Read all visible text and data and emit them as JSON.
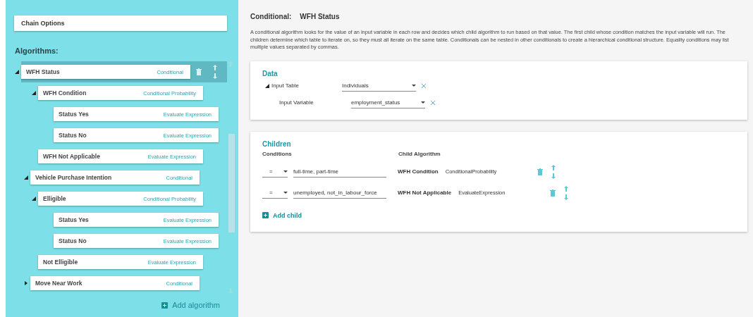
{
  "sidebar": {
    "chain_options": "Chain Options",
    "heading": "Algorithms:",
    "algorithms": [
      {
        "name": "WFH Status",
        "type": "Conditional",
        "selected": true,
        "expanded": true,
        "children": [
          {
            "name": "WFH Condition",
            "type": "Conditional Probability",
            "selected": false,
            "expanded": true,
            "children": [
              {
                "name": "Status Yes",
                "type": "Evaluate Expression",
                "selected": false
              },
              {
                "name": "Status No",
                "type": "Evaluate Expression",
                "selected": false
              }
            ]
          },
          {
            "name": "WFH Not Applicable",
            "type": "Evaluate Expression",
            "selected": false
          }
        ]
      },
      {
        "name": "Vehicle Purchase Intention",
        "type": "Conditional",
        "selected": false,
        "expanded": true,
        "children": [
          {
            "name": "Elligible",
            "type": "Conditional Probability",
            "selected": false,
            "expanded": true,
            "children": [
              {
                "name": "Status Yes",
                "type": "Evaluate Expression",
                "selected": false
              },
              {
                "name": "Status No",
                "type": "Evaluate Expression",
                "selected": false
              }
            ]
          },
          {
            "name": "Not Elligible",
            "type": "Evaluate Expression",
            "selected": false
          }
        ]
      },
      {
        "name": "Move Near Work",
        "type": "Conditional",
        "selected": false,
        "expanded": false
      }
    ],
    "add_button": "Add algorithm"
  },
  "detail": {
    "kind_label": "Conditional:",
    "title": "WFH Status",
    "description": "A conditional algorithm looks for the value of an input variable in each row and decides which child algorithm to run based on that value. The first child whose condition matches the input variable will run. The children determine which table to iterate on, so they must all iterate on the same table. Conditionals can be nested in other conditionals to create a hierarchical conditional structure. Equality conditions may list multiple values separated by commas.",
    "data": {
      "heading": "Data",
      "table_label": "Input Table",
      "table_value": "Individuals",
      "variable_label": "Input Variable",
      "variable_value": "employment_status"
    },
    "children": {
      "heading": "Children",
      "conditions_label": "Conditions",
      "algorithm_label": "Child Algorithm",
      "rows": [
        {
          "operator": "=",
          "values": "full-time, part-time",
          "child": "WFH Condition",
          "child_type": "ConditionalProbability"
        },
        {
          "operator": "=",
          "values": "unemployed, not_in_labour_force",
          "child": "WFH Not Applicable",
          "child_type": "EvaluateExpression"
        }
      ],
      "add_button": "Add child"
    }
  }
}
